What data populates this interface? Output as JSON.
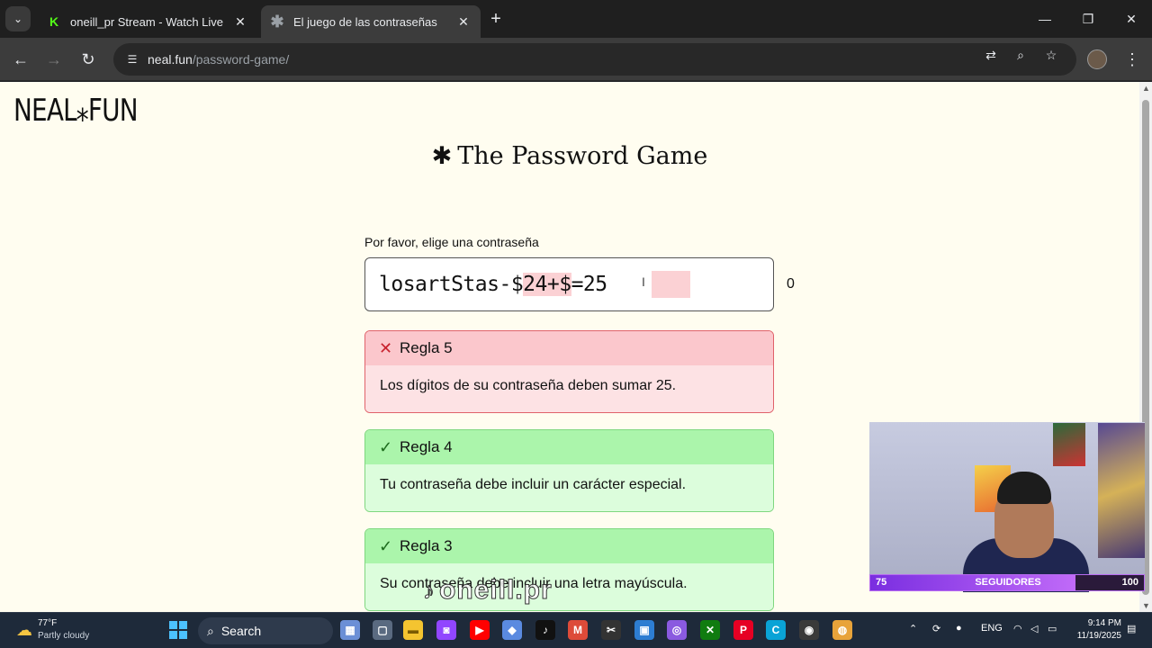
{
  "browser": {
    "tabs": [
      {
        "title": "oneill_pr Stream - Watch Live o",
        "favicon": "kick-icon"
      },
      {
        "title": "El juego de las contraseñas",
        "favicon": "asterisk-icon"
      }
    ],
    "url_domain": "neal.fun",
    "url_path": "/password-game/"
  },
  "page": {
    "logo": "NEAL⁎FUN",
    "title_star": "✱",
    "title": "The Password Game",
    "prompt": "Por favor, elige una contraseña",
    "password_parts": {
      "p1": "losartStas-$",
      "p2": "24+$",
      "p3": "=25"
    },
    "char_count": "0",
    "rules": [
      {
        "status": "fail",
        "mark": "✕",
        "title": "Regla 5",
        "text": "Los dígitos de su contraseña deben sumar 25."
      },
      {
        "status": "pass",
        "mark": "✓",
        "title": "Regla 4",
        "text": "Tu contraseña debe incluir un carácter especial."
      },
      {
        "status": "pass",
        "mark": "✓",
        "title": "Regla 3",
        "text": "Su contraseña debe incluir una letra mayúscula."
      }
    ],
    "watermark": "oneill.pr"
  },
  "overlay": {
    "followers_current": "75",
    "followers_label": "SEGUIDORES",
    "followers_goal": "100",
    "followers_progress": 0.75
  },
  "taskbar": {
    "weather_temp": "77°F",
    "weather_desc": "Partly cloudy",
    "search": "Search",
    "lang": "ENG",
    "time": "9:14 PM",
    "date": "11/19/2025"
  }
}
